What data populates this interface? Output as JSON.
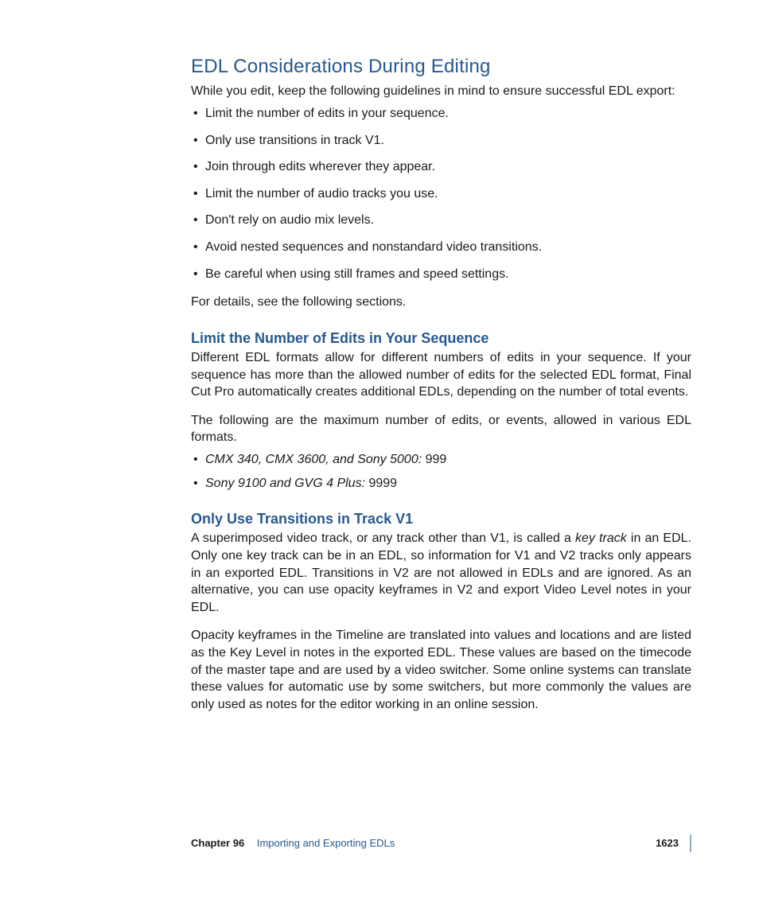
{
  "heading": "EDL Considerations During Editing",
  "intro": "While you edit, keep the following guidelines in mind to ensure successful EDL export:",
  "bullets": [
    "Limit the number of edits in your sequence.",
    "Only use transitions in track V1.",
    "Join through edits wherever they appear.",
    "Limit the number of audio tracks you use.",
    "Don't rely on audio mix levels.",
    "Avoid nested sequences and nonstandard video transitions.",
    "Be careful when using still frames and speed settings."
  ],
  "after_bullets": "For details, see the following sections.",
  "section1": {
    "title": "Limit the Number of Edits in Your Sequence",
    "para1": "Different EDL formats allow for different numbers of edits in your sequence. If your sequence has more than the allowed number of edits for the selected EDL format, Final Cut Pro automatically creates additional EDLs, depending on the number of total events.",
    "para2": "The following are the maximum number of edits, or events, allowed in various EDL formats.",
    "items": [
      {
        "name": "CMX 340, CMX 3600, and Sony 5000:",
        "value": " 999"
      },
      {
        "name": "Sony 9100 and GVG 4 Plus:",
        "value": " 9999"
      }
    ]
  },
  "section2": {
    "title": "Only Use Transitions in Track V1",
    "para1_a": "A superimposed video track, or any track other than V1, is called a ",
    "para1_em": "key track",
    "para1_b": " in an EDL. Only one key track can be in an EDL, so information for V1 and V2 tracks only appears in an exported EDL. Transitions in V2 are not allowed in EDLs and are ignored. As an alternative, you can use opacity keyframes in V2 and export Video Level notes in your EDL.",
    "para2": "Opacity keyframes in the Timeline are translated into values and locations and are listed as the Key Level in notes in the exported EDL. These values are based on the timecode of the master tape and are used by a video switcher. Some online systems can translate these values for automatic use by some switchers, but more commonly the values are only used as notes for the editor working in an online session."
  },
  "footer": {
    "chapter_label": "Chapter 96",
    "chapter_title": "Importing and Exporting EDLs",
    "page_number": "1623"
  }
}
